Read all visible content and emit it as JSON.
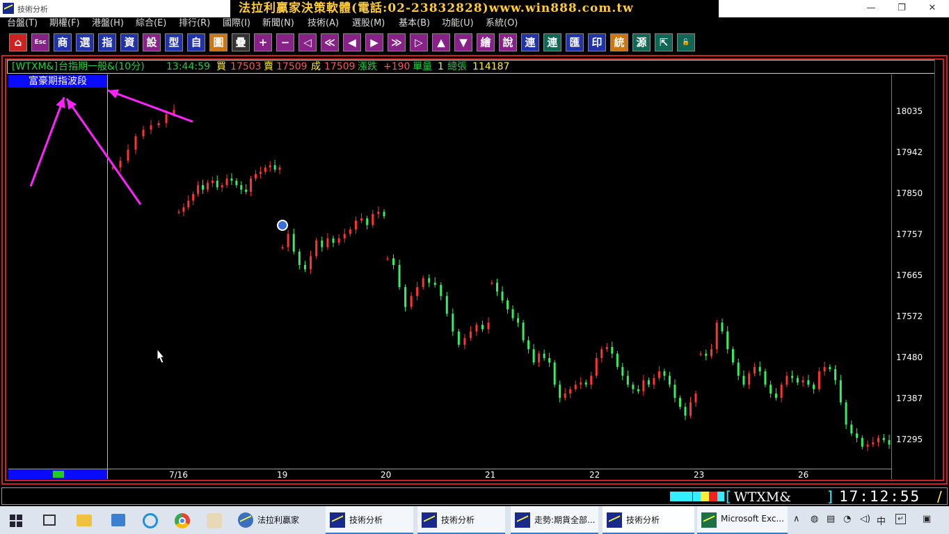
{
  "window": {
    "title": "技術分析",
    "banner": "法拉利贏家決策軟體(電話:02-23832828)www.win888.com.tw",
    "minimize": "—",
    "maximize": "❐",
    "close": "✕"
  },
  "menu": [
    "台盤(T)",
    "期權(F)",
    "港盤(H)",
    "綜合(E)",
    "排行(R)",
    "國際(I)",
    "新聞(N)",
    "技術(A)",
    "選股(M)",
    "基本(B)",
    "功能(U)",
    "系統(O)"
  ],
  "toolbar": [
    {
      "label": "⌂",
      "icon": "home-icon",
      "bg": "#cc2222"
    },
    {
      "label": "Esc",
      "icon": "esc-icon",
      "bg": "#882288"
    },
    {
      "label": "商",
      "icon": "goods-icon",
      "bg": "#2233aa"
    },
    {
      "label": "選",
      "icon": "select-icon",
      "bg": "#2233aa"
    },
    {
      "label": "指",
      "icon": "index-icon",
      "bg": "#2233aa"
    },
    {
      "label": "資",
      "icon": "data-icon",
      "bg": "#2233aa"
    },
    {
      "label": "設",
      "icon": "settings-icon",
      "bg": "#882288"
    },
    {
      "label": "型",
      "icon": "pattern-icon",
      "bg": "#2233aa"
    },
    {
      "label": "自",
      "icon": "custom-icon",
      "bg": "#2233aa"
    },
    {
      "label": "圖",
      "icon": "chart-icon",
      "bg": "#cc7711"
    },
    {
      "label": "疊",
      "icon": "overlay-icon",
      "bg": "#333333"
    },
    {
      "label": "+",
      "icon": "plus-icon",
      "bg": "#882288"
    },
    {
      "label": "−",
      "icon": "minus-icon",
      "bg": "#882288"
    },
    {
      "label": "◁",
      "icon": "left-bar-icon",
      "bg": "#882288"
    },
    {
      "label": "≪",
      "icon": "rewind-icon",
      "bg": "#882288"
    },
    {
      "label": "◀",
      "icon": "back-icon",
      "bg": "#882288"
    },
    {
      "label": "▶",
      "icon": "forward-icon",
      "bg": "#882288"
    },
    {
      "label": "≫",
      "icon": "fast-forward-icon",
      "bg": "#882288"
    },
    {
      "label": "▷",
      "icon": "right-bar-icon",
      "bg": "#882288"
    },
    {
      "label": "▲",
      "icon": "up-icon",
      "bg": "#882288"
    },
    {
      "label": "▼",
      "icon": "down-icon",
      "bg": "#882288"
    },
    {
      "label": "繪",
      "icon": "draw-icon",
      "bg": "#882288"
    },
    {
      "label": "說",
      "icon": "explain-icon",
      "bg": "#882288"
    },
    {
      "label": "連",
      "icon": "link-icon",
      "bg": "#2233aa"
    },
    {
      "label": "連",
      "icon": "link2-icon",
      "bg": "#116655"
    },
    {
      "label": "匯",
      "icon": "export-icon",
      "bg": "#2233aa"
    },
    {
      "label": "印",
      "icon": "print-icon",
      "bg": "#2233aa"
    },
    {
      "label": "統",
      "icon": "stats-icon",
      "bg": "#cc7711"
    },
    {
      "label": "源",
      "icon": "source-icon",
      "bg": "#116655"
    },
    {
      "label": "⇱",
      "icon": "window-icon",
      "bg": "#116655"
    },
    {
      "label": "🔓",
      "icon": "unlock-icon",
      "bg": "#116655"
    }
  ],
  "quote": {
    "symbol": "[WTXM&]",
    "name": "台指期一般&(10分)",
    "time": "13:44:59",
    "bid_label": "買",
    "bid": "17503",
    "ask_label": "賣",
    "ask": "17509",
    "trade_label": "成",
    "trade": "17509",
    "change_label": "漲跌",
    "change": "+190",
    "unit_label": "單量",
    "unit": "1",
    "total_label": "總張",
    "total": "114187"
  },
  "indicator_label": "富豪期指波段",
  "colors": {
    "up": "#ff3333",
    "down": "#33ee66",
    "arrow": "#ff22ff",
    "accent": "#0a0aff",
    "frame": "#cc2222"
  },
  "chart_data": {
    "type": "candlestick",
    "title": "",
    "xlabel": "",
    "ylabel": "",
    "ylim": [
      17240,
      18090
    ],
    "y_ticks": [
      18035,
      17942,
      17850,
      17757,
      17665,
      17572,
      17480,
      17387,
      17295
    ],
    "x_ticks": [
      "7/16",
      "19",
      "20",
      "21",
      "22",
      "23",
      "26"
    ],
    "segments": [
      {
        "label": "7/16",
        "values": [
          17910,
          17925,
          17950,
          17980,
          17995,
          18005,
          18010,
          18030,
          18040
        ]
      },
      {
        "label": "19",
        "values": [
          17810,
          17820,
          17835,
          17850,
          17870,
          17860,
          17875,
          17880,
          17865,
          17870,
          17885,
          17880,
          17870,
          17860,
          17855,
          17885,
          17895,
          17900,
          17910,
          17915,
          17905,
          17910
        ]
      },
      {
        "label": "20",
        "values": [
          17730,
          17760,
          17720,
          17690,
          17680,
          17710,
          17745,
          17730,
          17750,
          17740,
          17750,
          17760,
          17770,
          17790,
          17795,
          17780,
          17805,
          17810,
          17800
        ]
      },
      {
        "label": "21",
        "values": [
          17705,
          17690,
          17640,
          17595,
          17620,
          17640,
          17660,
          17650,
          17645,
          17620,
          17580,
          17540,
          17510,
          17525,
          17540,
          17555,
          17545,
          17560
        ]
      },
      {
        "label": "22",
        "values": [
          17650,
          17630,
          17610,
          17590,
          17570,
          17560,
          17520,
          17500,
          17470,
          17490,
          17480,
          17470,
          17420,
          17390,
          17400,
          17410,
          17420,
          17425,
          17420,
          17440,
          17480,
          17500,
          17505,
          17490,
          17460,
          17440,
          17420,
          17410,
          17405,
          17430,
          17420,
          17435,
          17450,
          17440,
          17420,
          17390,
          17370,
          17350,
          17380,
          17400
        ]
      },
      {
        "label": "23",
        "values": [
          17490,
          17485,
          17500,
          17560,
          17540,
          17500,
          17470,
          17440,
          17420,
          17445,
          17460,
          17450,
          17420,
          17400,
          17390,
          17420,
          17440,
          17435,
          17425,
          17430,
          17420,
          17410,
          17450,
          17460,
          17455,
          17430,
          17380,
          17330,
          17310,
          17300,
          17280,
          17285,
          17290,
          17300,
          17295,
          17285
        ]
      }
    ]
  },
  "status": {
    "ticker": "WTXM&",
    "clock": "17:12:55"
  },
  "taskbar": {
    "apps": [
      {
        "label": "法拉利贏家",
        "icon": "ferrari-app-icon"
      },
      {
        "label": "技術分析",
        "icon": "tech-analysis-icon"
      },
      {
        "label": "技術分析",
        "icon": "tech-analysis-icon"
      },
      {
        "label": "走勢:期貨全部...",
        "icon": "trend-icon"
      },
      {
        "label": "技術分析",
        "icon": "tech-analysis-icon"
      },
      {
        "label": "Microsoft Exc...",
        "icon": "excel-icon"
      }
    ],
    "ime": "中"
  }
}
